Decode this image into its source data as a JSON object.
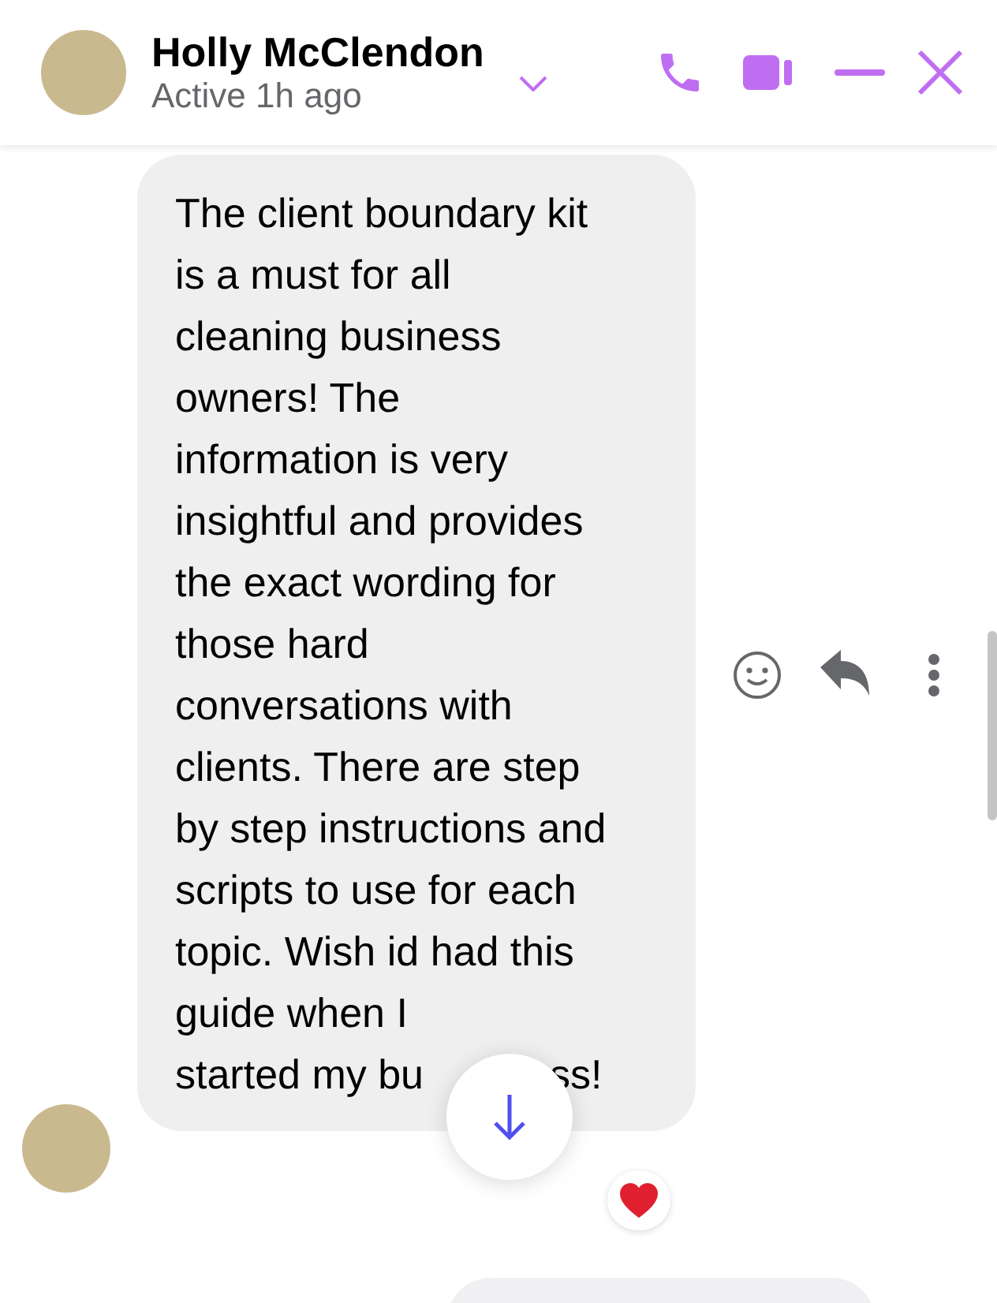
{
  "header": {
    "name": "Holly McClendon",
    "status": "Active 1h ago"
  },
  "message": {
    "text": "The client boundary kit is a must for all cleaning business owners! The information is very insightful and provides the exact wording for those hard conversations with clients. There are step by step instructions and scripts to use for each topic. Wish id had this guide when I",
    "last_line_start": "started my bu",
    "last_line_end": "ss!"
  }
}
